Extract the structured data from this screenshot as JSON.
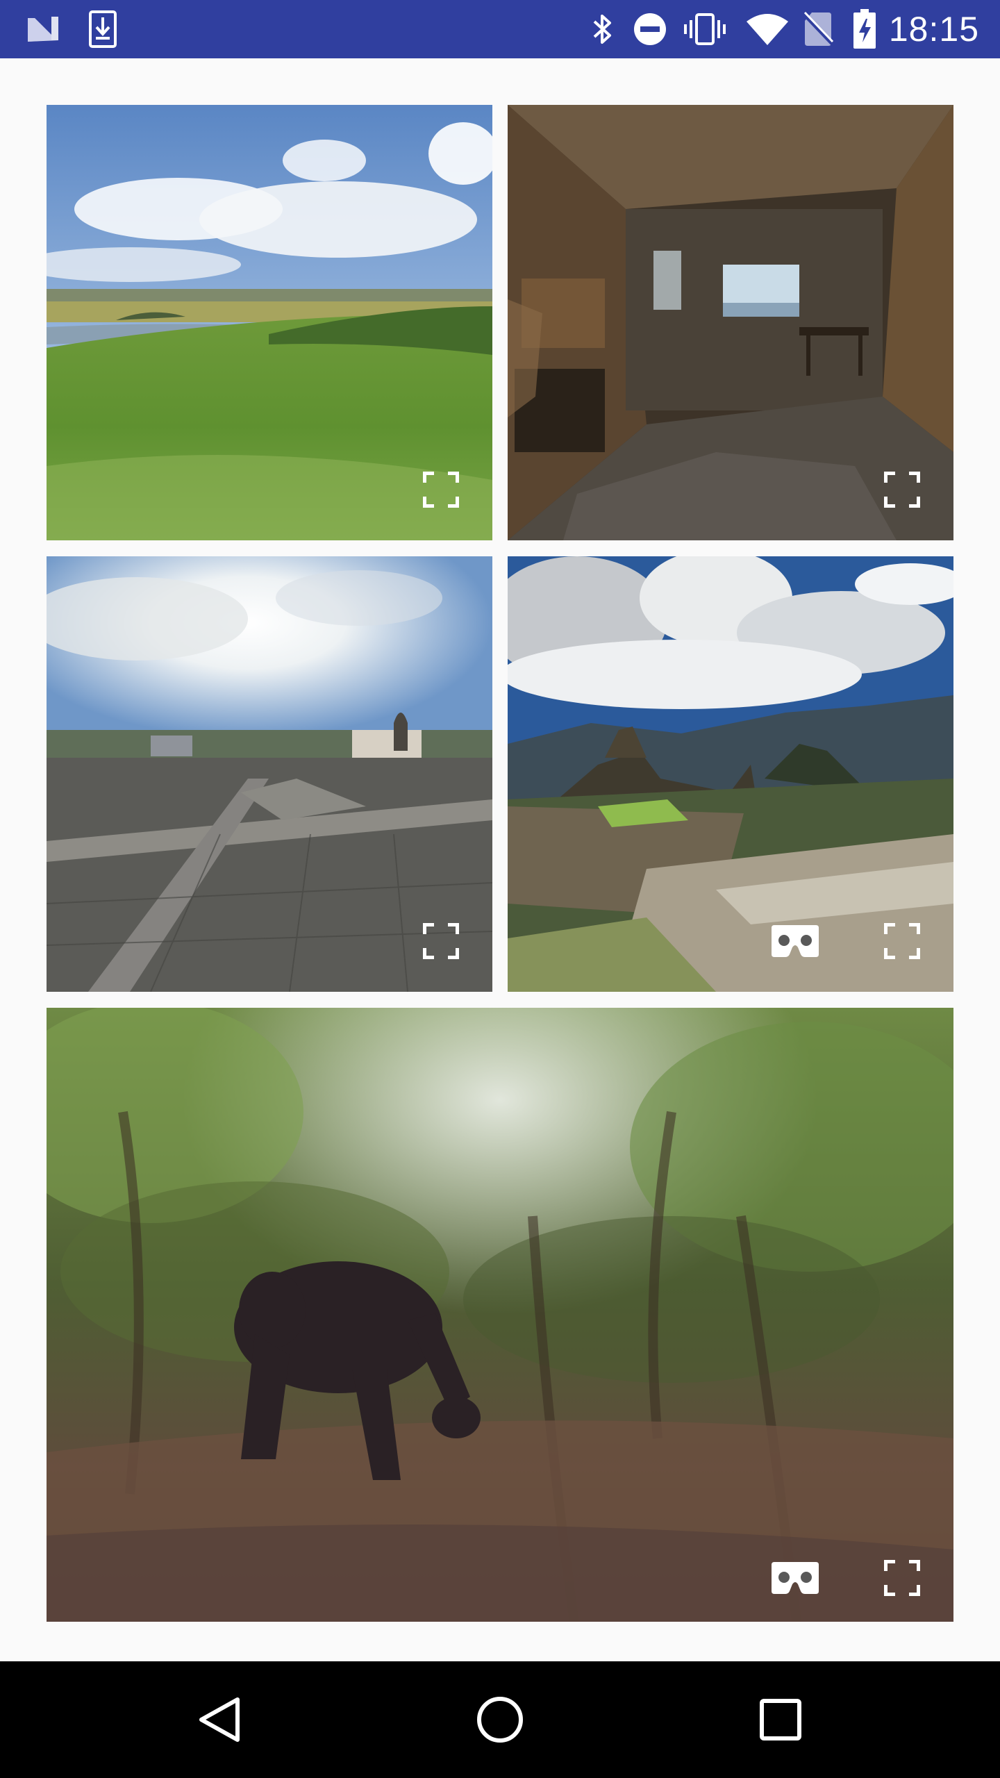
{
  "status_bar": {
    "time": "18:15",
    "background_color": "#303f9f",
    "left_icons": [
      "notification-n-icon",
      "download-icon"
    ],
    "right_icons": [
      "bluetooth-icon",
      "do-not-disturb-icon",
      "vibrate-icon",
      "wifi-icon",
      "no-sim-icon",
      "battery-charging-icon"
    ]
  },
  "gallery": {
    "background_color": "#fafafa",
    "tiles": [
      {
        "scene": "grassy-hill-panorama",
        "buttons": [
          "fullscreen-icon"
        ]
      },
      {
        "scene": "abandoned-room-panorama",
        "buttons": [
          "fullscreen-icon"
        ]
      },
      {
        "scene": "city-plaza-panorama",
        "buttons": [
          "fullscreen-icon"
        ]
      },
      {
        "scene": "machu-picchu-panorama",
        "buttons": [
          "cardboard-vr-icon",
          "fullscreen-icon"
        ]
      },
      {
        "scene": "gorilla-forest-video",
        "buttons": [
          "cardboard-vr-icon",
          "fullscreen-icon"
        ]
      }
    ]
  },
  "nav_bar": {
    "background_color": "#000000",
    "buttons": [
      "back-icon",
      "home-icon",
      "recents-icon"
    ]
  }
}
